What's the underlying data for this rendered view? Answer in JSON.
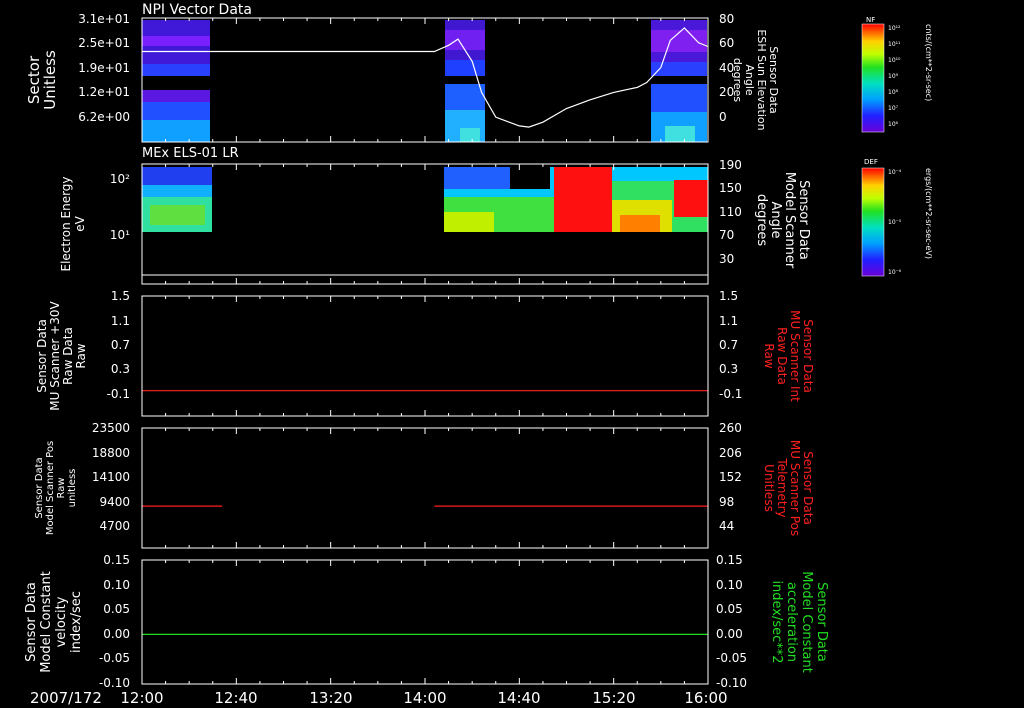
{
  "colors": {
    "background": "#000000",
    "axis": "#ffffff",
    "red_trace": "#ff2020",
    "green_trace": "#22dd22"
  },
  "date_label": "2007/172",
  "time_ticks": [
    "12:00",
    "12:40",
    "13:20",
    "14:00",
    "14:40",
    "15:20",
    "16:00"
  ],
  "chart_data": [
    {
      "type": "heatmap",
      "title": "NPI Vector Data",
      "ylabel_left": [
        "Sector",
        "Unitless"
      ],
      "yticks_left": [
        "3.1e+01",
        "2.5e+01",
        "1.9e+01",
        "1.2e+01",
        "6.2e+00"
      ],
      "ylabel_right": [
        "Sensor Data",
        "ESH Sun Elevation",
        "Angle",
        "degrees"
      ],
      "yticks_right": [
        "80",
        "60",
        "40",
        "20",
        "0"
      ],
      "ylim_right": [
        -20,
        80
      ],
      "time_range": [
        "12:00",
        "16:00"
      ],
      "data_intervals": [
        [
          "12:00",
          "12:32"
        ],
        [
          "14:04",
          "14:20"
        ],
        [
          "15:34",
          "16:00"
        ]
      ],
      "overlay_line": {
        "x": [
          "12:00",
          "14:04",
          "14:10",
          "14:14",
          "14:20",
          "14:24",
          "14:30",
          "14:40",
          "14:44",
          "14:50",
          "15:00",
          "15:10",
          "15:20",
          "15:30",
          "15:34",
          "15:40",
          "15:44",
          "15:50",
          "15:56",
          "16:00"
        ],
        "y": [
          53,
          53,
          58,
          63,
          45,
          20,
          0,
          -7,
          -8,
          -4,
          7,
          14,
          20,
          24,
          28,
          40,
          62,
          72,
          60,
          57
        ]
      },
      "colorbar": {
        "label": "NF",
        "units": "cnts/(cm**2-sr-sec)",
        "ticks": [
          "10¹²",
          "10¹¹",
          "10¹⁰",
          "10⁹",
          "10⁸",
          "10⁷",
          "10⁶"
        ]
      }
    },
    {
      "type": "heatmap",
      "title": "MEx ELS-01 LR",
      "ylabel_left": [
        "Electron Energy",
        "eV"
      ],
      "yticks_left": [
        "10²",
        "10¹"
      ],
      "ylabel_right": [
        "Sensor Data",
        "Model Scanner",
        "Angle",
        "degrees"
      ],
      "yticks_right": [
        "190",
        "150",
        "110",
        "70",
        "30"
      ],
      "ylim_right": [
        -10,
        190
      ],
      "time_range": [
        "12:00",
        "16:00"
      ],
      "data_intervals": [
        [
          "12:00",
          "12:32"
        ],
        [
          "14:04",
          "16:00"
        ]
      ],
      "overlay_line": {
        "x": [
          "12:00",
          "16:00"
        ],
        "y": [
          5,
          5
        ]
      },
      "colorbar": {
        "label": "DEF",
        "units": "ergs/(cm**2-sr-sec-eV)",
        "ticks": [
          "10⁻⁴",
          "10⁻⁵",
          "10⁻⁶"
        ]
      }
    },
    {
      "type": "line",
      "ylabel_left": [
        "Sensor Data",
        "MU Scanner +30V",
        "Raw Data",
        "Raw"
      ],
      "yticks_left": [
        "1.5",
        "1.1",
        "0.7",
        "0.3",
        "-0.1"
      ],
      "ylim_left": [
        -0.4,
        1.5
      ],
      "ylabel_right": [
        "Sensor Data",
        "MU Scanner Int",
        "Raw Data",
        "Raw"
      ],
      "yticks_right": [
        "1.5",
        "1.1",
        "0.7",
        "0.3",
        "-0.1"
      ],
      "series": [
        {
          "color": "#ff2020",
          "x": [
            "12:00",
            "16:00"
          ],
          "y": [
            0.0,
            0.0
          ]
        }
      ]
    },
    {
      "type": "line",
      "ylabel_left": [
        "Sensor Data",
        "Model Scanner Pos",
        "Raw",
        "unitless"
      ],
      "yticks_left": [
        "23500",
        "18800",
        "14100",
        "9400",
        "4700"
      ],
      "ylim_left": [
        0,
        23500
      ],
      "ylabel_right": [
        "Sensor Data",
        "MU Scanner Pos",
        "Telemetry",
        "Unitless"
      ],
      "yticks_right": [
        "260",
        "206",
        "152",
        "98",
        "44"
      ],
      "series": [
        {
          "color": "#ff2020",
          "x": [
            "12:00",
            "12:34"
          ],
          "y": [
            8200,
            8200
          ]
        },
        {
          "color": "#ff2020",
          "x": [
            "14:04",
            "16:00"
          ],
          "y": [
            8200,
            8200
          ]
        }
      ]
    },
    {
      "type": "line",
      "ylabel_left": [
        "Sensor Data",
        "Model Constant",
        "velocity",
        "index/sec"
      ],
      "yticks_left": [
        "0.15",
        "0.10",
        "0.05",
        "0.00",
        "-0.05",
        "-0.10"
      ],
      "ylim_left": [
        -0.1,
        0.15
      ],
      "ylabel_right": [
        "Sensor Data",
        "Model Constant",
        "acceleration",
        "index/sec**2"
      ],
      "yticks_right": [
        "0.15",
        "0.10",
        "0.05",
        "0.00",
        "-0.05",
        "-0.10"
      ],
      "series": [
        {
          "color": "#22dd22",
          "x": [
            "12:00",
            "16:00"
          ],
          "y": [
            0.0,
            0.0
          ]
        }
      ]
    }
  ]
}
